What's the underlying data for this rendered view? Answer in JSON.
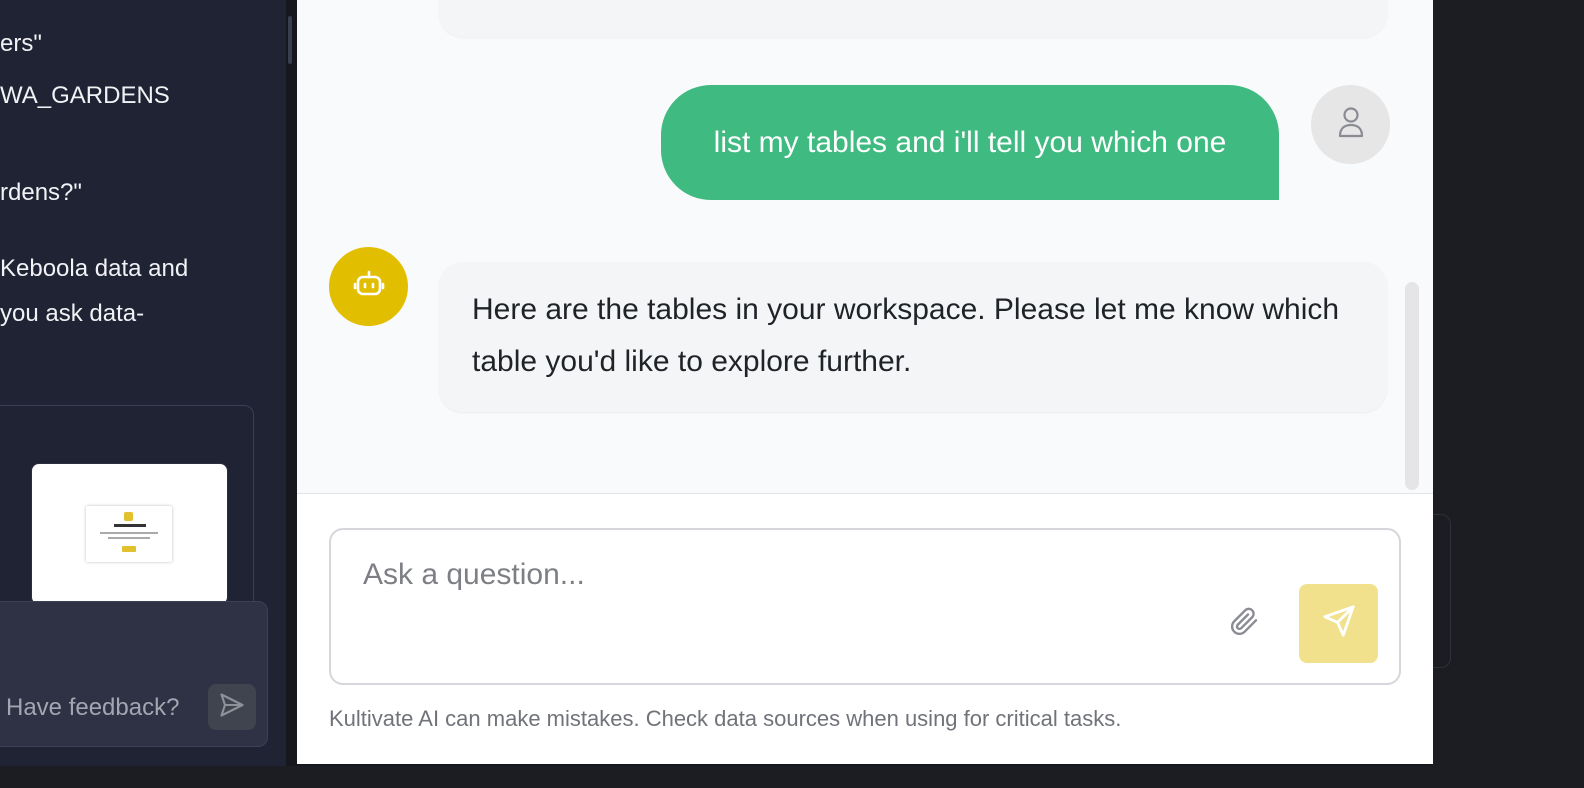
{
  "sidebar": {
    "history_lines": [
      "ers\"",
      "WA_GARDENS",
      "rdens?\"",
      " Keboola data and",
      " you ask data-"
    ],
    "feedback_placeholder": "Have feedback?"
  },
  "chat": {
    "messages": [
      {
        "role": "user",
        "text": "list my tables and i'll tell you which one"
      },
      {
        "role": "assistant",
        "text": "Here are the tables in your workspace. Please let me know which table you'd like to explore further."
      }
    ],
    "input_placeholder": "Ask a question...",
    "disclaimer": "Kultivate AI can make mistakes. Check data sources when using for critical tasks."
  },
  "colors": {
    "user_bubble": "#3fba80",
    "bot_avatar": "#e2be00",
    "send_button": "#f1e08c",
    "sidebar_bg": "#1f2333"
  },
  "icons": {
    "user_avatar": "user-icon",
    "bot_avatar": "robot-icon",
    "attach": "paperclip-icon",
    "send": "send-icon"
  }
}
